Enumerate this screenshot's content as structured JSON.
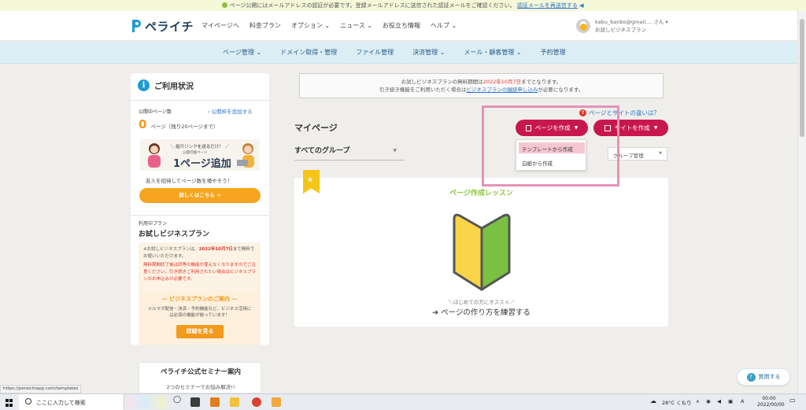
{
  "notice": {
    "text": "ページ公開にはメールアドレスの認証が必要です。登録メールアドレスに送信された認証メールをご確認ください。",
    "link": "認証メールを再送信する"
  },
  "header": {
    "logo_text": "ペライチ",
    "nav": [
      "マイページへ",
      "料金プラン",
      "オプション ⌄",
      "ニュース ⌄",
      "お役立ち情報",
      "ヘルプ ⌄"
    ],
    "account_email": "kabu_banbo@gmail.... さん ▾",
    "account_plan": "お試しビジネスプラン"
  },
  "subnav": [
    "ページ管理 ⌄",
    "ドメイン取得・管理",
    "ファイル管理",
    "決済管理 ⌄",
    "メール・顧客管理 ⌄",
    "予約管理"
  ],
  "sidebar": {
    "title": "ご利用状況",
    "pages_label": "公開中ページ数",
    "pages_link": "› 公開枠を追加する",
    "pages_count": "0",
    "pages_unit": "ページ（残り20ページまで）",
    "banner_line1": "＼ 紹介リンクを送るだけ！ ／",
    "banner_line2": "公開可能ページ",
    "banner_line3": "1ページ追加",
    "invite_text": "友人を招待してページ数を増やそう！",
    "invite_button": "詳しくはこちら ➔",
    "plan_label": "利用中プラン",
    "plan_name": "お試しビジネスプラン",
    "plan_text_1": "※お試しビジネスプランは、",
    "plan_date": "2022年10月7日",
    "plan_text_2": "まで無料でお使いいただけます。",
    "plan_warning": "無料期間終了後は同等の機能が使えなくなりますのでご注意ください。引き続きご利用されたい場合はビジネスプランのお申込みが必要です。",
    "guide_title": "— ビジネスプランのご案内 —",
    "guide_text": "メルマガ配信・決済・予約機能など、ビジネス活用には必須の機能が揃っています！",
    "guide_button": "詳細を見る",
    "seminar_title": "ペライチ公式セミナー案内",
    "seminar_sub": "2つのセミナーでお悩み解決!!"
  },
  "main": {
    "trial_text_1": "お試しビジネスプランの無料期間は",
    "trial_date": "2022年10月7日",
    "trial_text_2": "までとなります。",
    "trial_text_3": "引き続き機能をご利用いただく場合は",
    "trial_link": "ビジネスプランの継続申し込み",
    "trial_text_4": "が必要になります。",
    "diff_link": "ページとサイトの違いは？",
    "title": "マイページ",
    "create_page_button": "ページを作成",
    "create_site_button": "サイトを作成",
    "dropdown_items": [
      "テンプレートから作成",
      "白紙から作成"
    ],
    "group_select": "すべてのグループ",
    "group_mgmt": "グループ管理",
    "lesson_title": "ページ作成レッスン",
    "lesson_sub": "＼はじめての方にオススメ／",
    "lesson_link": "ページの作り方を練習する"
  },
  "help_button": "質問する",
  "url_tip": "https://peraichiapp.com/templates",
  "taskbar": {
    "search_placeholder": "ここに入力して検索",
    "weather": "28°C くもり",
    "ime": "A",
    "time": "00:00",
    "date": "2022/00/00"
  },
  "colors": {
    "accent": "#c8174f",
    "orange": "#f7a41e",
    "green": "#8cc63f",
    "highlight": "#e693b8"
  }
}
